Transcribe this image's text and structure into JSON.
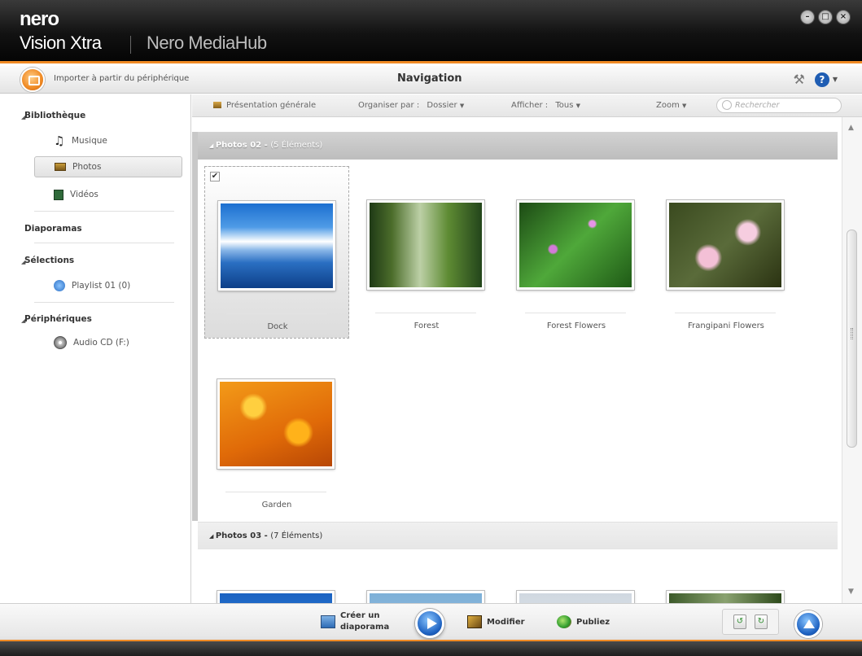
{
  "window": {
    "brand": "nero",
    "product": "Vision Xtra",
    "module": "Nero MediaHub",
    "controls": {
      "minimize": "–",
      "maximize": "□",
      "close": "×"
    }
  },
  "toolbar": {
    "import_label": "Importer à partir du périphérique",
    "title": "Navigation",
    "help": "?"
  },
  "sidebar": {
    "library": {
      "heading": "Bibliothèque",
      "items": [
        {
          "label": "Musique",
          "icon": "music-note-icon"
        },
        {
          "label": "Photos",
          "icon": "photo-icon",
          "selected": true
        },
        {
          "label": "Vidéos",
          "icon": "film-icon"
        }
      ]
    },
    "slideshows": {
      "heading": "Diaporamas"
    },
    "selections": {
      "heading": "Sélections",
      "items": [
        {
          "label": "Playlist 01 (0)",
          "icon": "playlist-icon"
        }
      ]
    },
    "devices": {
      "heading": "Périphériques",
      "items": [
        {
          "label": "Audio CD (F:)",
          "icon": "cd-icon"
        }
      ]
    }
  },
  "content_toolbar": {
    "overview": "Présentation générale",
    "organize_label": "Organiser par :",
    "organize_value": "Dossier",
    "show_label": "Afficher :",
    "show_value": "Tous",
    "zoom": "Zoom",
    "search_placeholder": "Rechercher"
  },
  "groups": [
    {
      "title": "Photos 02",
      "count": "(5 Éléments)",
      "items": [
        {
          "caption": "Dock",
          "selected": true,
          "checked": true
        },
        {
          "caption": "Forest"
        },
        {
          "caption": "Forest Flowers"
        },
        {
          "caption": "Frangipani Flowers"
        },
        {
          "caption": "Garden"
        }
      ]
    },
    {
      "title": "Photos 03",
      "count": "(7 Éléments)"
    }
  ],
  "bottom": {
    "create_slideshow_line1": "Créer un",
    "create_slideshow_line2": "diaporama",
    "edit": "Modifier",
    "publish": "Publiez"
  },
  "colors": {
    "accent_orange": "#f08a24",
    "titlebar": "#121212",
    "play_blue": "#1f63c2"
  }
}
